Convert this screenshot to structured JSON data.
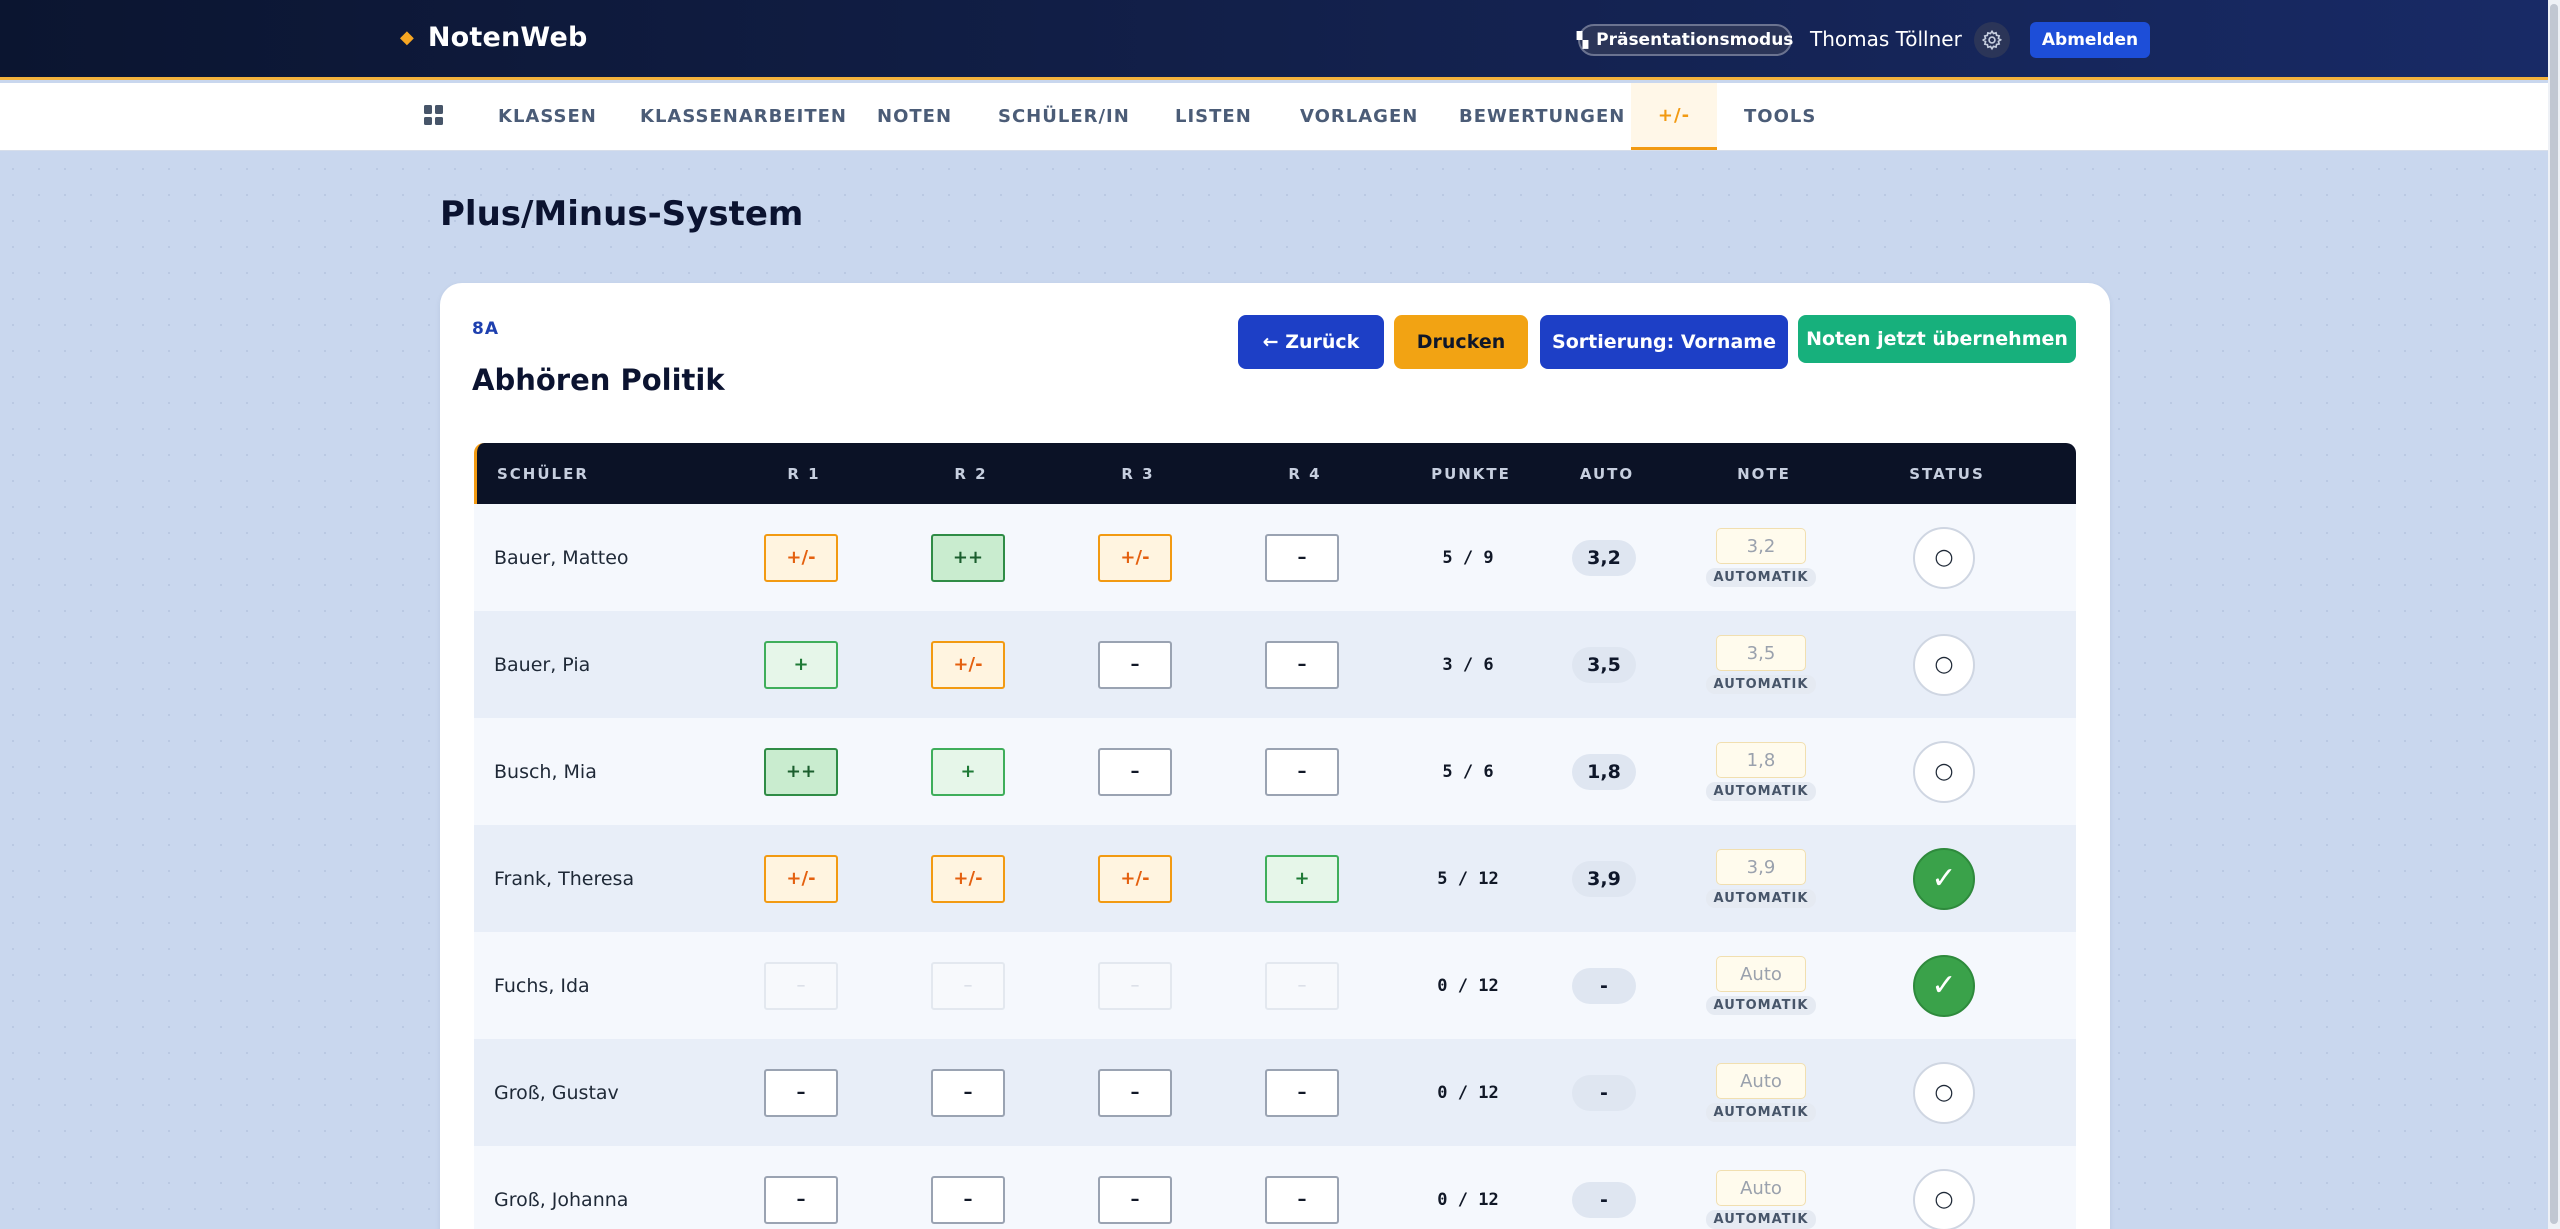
{
  "app": {
    "brand": "NotenWeb",
    "presentation_mode": "Präsentationsmodus",
    "user": "Thomas Töllner",
    "logout": "Abmelden"
  },
  "nav": {
    "items": [
      "KLASSEN",
      "KLASSENARBEITEN",
      "NOTEN",
      "SCHÜLER/IN",
      "LISTEN",
      "VORLAGEN",
      "BEWERTUNGEN",
      "+/-",
      "TOOLS"
    ],
    "active": "+/-"
  },
  "page": {
    "title": "Plus/Minus-System",
    "class": "8A",
    "subject": "Abhören Politik"
  },
  "buttons": {
    "back": "← Zurück",
    "print": "Drucken",
    "sort": "Sortierung: Vorname",
    "apply": "Noten jetzt übernehmen"
  },
  "table": {
    "headers": {
      "student": "SCHÜLER",
      "r1": "R 1",
      "r2": "R 2",
      "r3": "R 3",
      "r4": "R 4",
      "points": "PUNKTE",
      "auto": "AUTO",
      "grade": "NOTE",
      "status": "STATUS"
    },
    "rows": [
      {
        "name": "Bauer, Matteo",
        "marks": [
          "+/-",
          "++",
          "+/-",
          "–"
        ],
        "points": "5 / 9",
        "auto": "3,2",
        "grade": "3,2",
        "grade_label": "AUTOMATIK",
        "status": "○"
      },
      {
        "name": "Bauer, Pia",
        "marks": [
          "+",
          "+/-",
          "–",
          "–"
        ],
        "points": "3 / 6",
        "auto": "3,5",
        "grade": "3,5",
        "grade_label": "AUTOMATIK",
        "status": "○"
      },
      {
        "name": "Busch, Mia",
        "marks": [
          "++",
          "+",
          "–",
          "–"
        ],
        "points": "5 / 6",
        "auto": "1,8",
        "grade": "1,8",
        "grade_label": "AUTOMATIK",
        "status": "○"
      },
      {
        "name": "Frank, Theresa",
        "marks": [
          "+/-",
          "+/-",
          "+/-",
          "+"
        ],
        "points": "5 / 12",
        "auto": "3,9",
        "grade": "3,9",
        "grade_label": "AUTOMATIK",
        "status": "✓"
      },
      {
        "name": "Fuchs, Ida",
        "marks": [
          "–",
          "–",
          "–",
          "–"
        ],
        "points": "0 / 12",
        "auto": "-",
        "grade": "Auto",
        "grade_label": "AUTOMATIK",
        "status": "✓"
      },
      {
        "name": "Groß, Gustav",
        "marks": [
          "–",
          "–",
          "–",
          "–"
        ],
        "points": "0 / 12",
        "auto": "-",
        "grade": "Auto",
        "grade_label": "AUTOMATIK",
        "status": "○"
      },
      {
        "name": "Groß, Johanna",
        "marks": [
          "–",
          "–",
          "–",
          "–"
        ],
        "points": "0 / 12",
        "auto": "-",
        "grade": "Auto",
        "grade_label": "AUTOMATIK",
        "status": "○"
      }
    ]
  },
  "colors": {
    "accent": "#f29a12",
    "primary": "#1d3fc6",
    "success": "#17b07c",
    "header_dark": "#0b1226"
  }
}
